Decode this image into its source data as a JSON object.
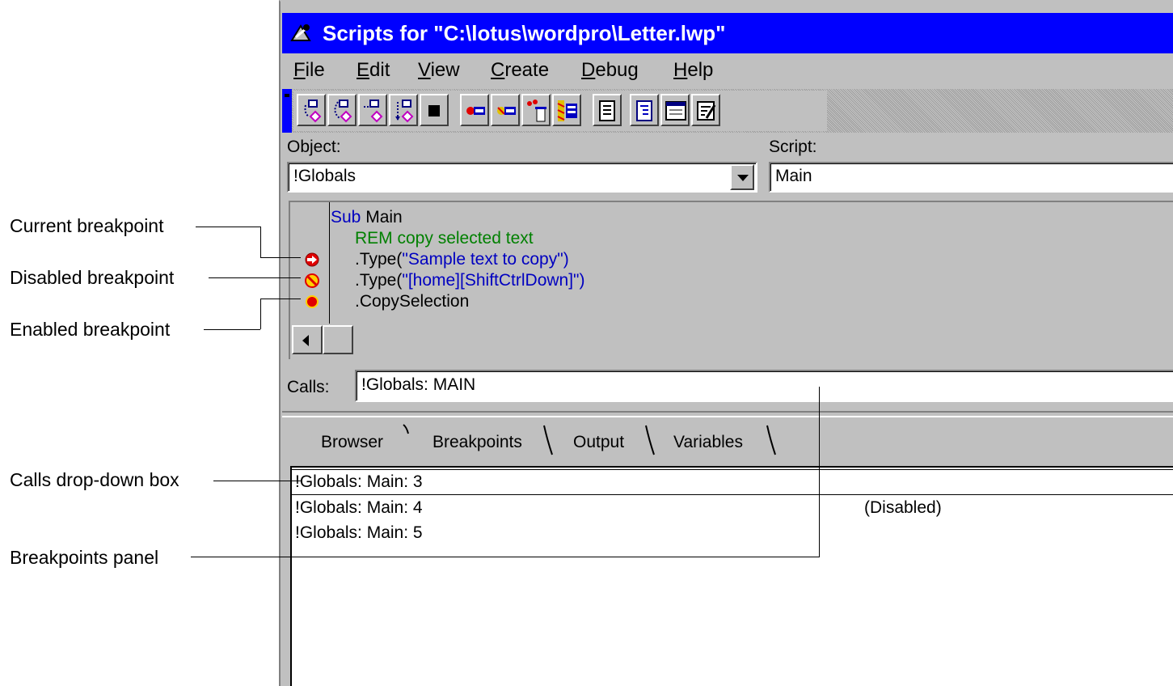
{
  "window": {
    "title": "Scripts for \"C:\\lotus\\wordpro\\Letter.lwp\""
  },
  "menu": [
    {
      "pre": "",
      "ul": "F",
      "post": "ile"
    },
    {
      "pre": "",
      "ul": "E",
      "post": "dit"
    },
    {
      "pre": "",
      "ul": "V",
      "post": "iew"
    },
    {
      "pre": "",
      "ul": "C",
      "post": "reate"
    },
    {
      "pre": "",
      "ul": "D",
      "post": "ebug"
    },
    {
      "pre": "",
      "ul": "H",
      "post": "elp"
    }
  ],
  "toolbar": {
    "buttons": [
      "step-into-icon",
      "step-over-icon",
      "step-exit-icon",
      "run-to-cursor-icon",
      "stop-icon",
      "set-breakpoint-icon",
      "toggle-breakpoint-icon",
      "clear-breakpoints-icon",
      "breakpoints-list-icon",
      "browser-icon",
      "outline-icon",
      "window-icon",
      "notes-icon"
    ]
  },
  "object_section": {
    "object_label": "Object:",
    "object_value": "!Globals",
    "script_label": "Script:",
    "script_value": "Main"
  },
  "code": {
    "line1_kw": "Sub",
    "line1_rest": " Main",
    "line2": "REM copy selected text",
    "line3_a": ".Type(",
    "line3_b": "\"Sample text to copy\"",
    "line3_c": ")",
    "line4_a": ".Type(",
    "line4_b": "\"[home][ShiftCtrlDown]\"",
    "line4_c": ")",
    "line5": ".CopySelection"
  },
  "calls": {
    "label": "Calls:",
    "value": "!Globals: MAIN"
  },
  "tabs": [
    "Browser",
    "Breakpoints",
    "Output",
    "Variables"
  ],
  "breakpoints": [
    {
      "location": "!Globals: Main: 3",
      "status": ""
    },
    {
      "location": "!Globals: Main: 4",
      "status": "(Disabled)"
    },
    {
      "location": "!Globals: Main: 5",
      "status": ""
    }
  ],
  "callouts": {
    "current": "Current breakpoint",
    "disabled": "Disabled breakpoint",
    "enabled": "Enabled breakpoint",
    "calls": "Calls drop-down box",
    "panel": "Breakpoints panel"
  },
  "colors": {
    "title_bar": "#0000ff",
    "keyword": "#0000c0",
    "comment": "#008000",
    "breakpoint": "#ff0000"
  }
}
